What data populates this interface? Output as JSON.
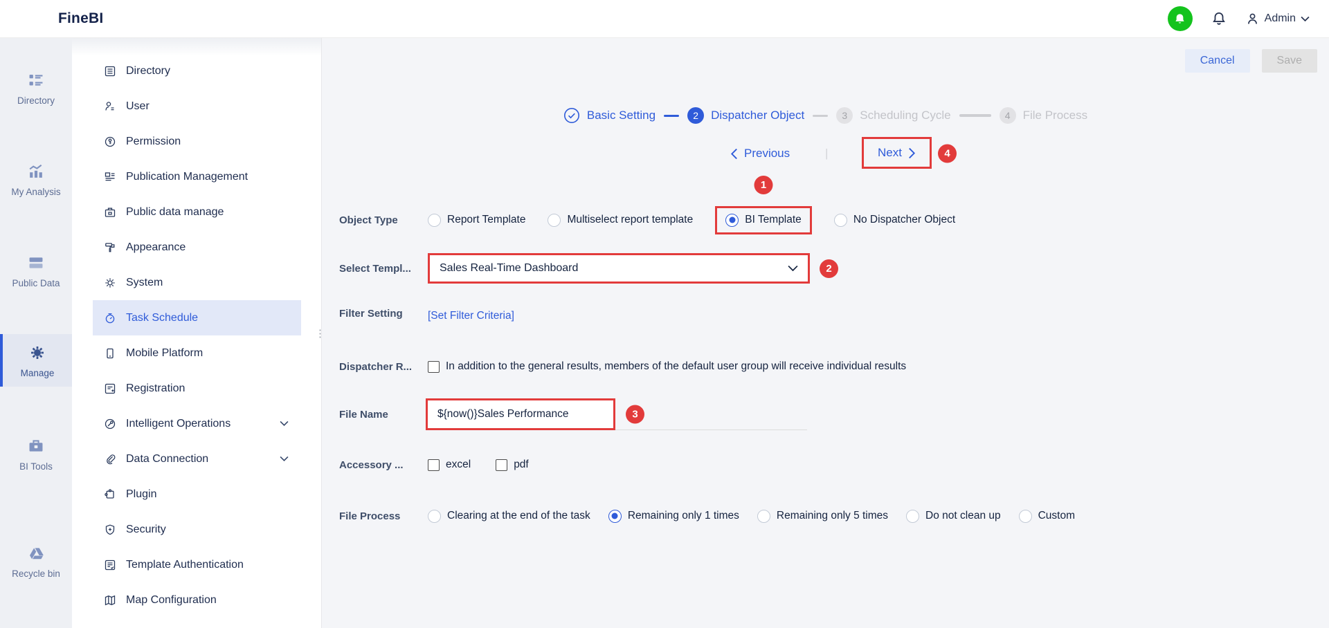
{
  "app": {
    "name": "FineBI"
  },
  "topbar": {
    "admin_label": "Admin"
  },
  "rail": {
    "items": [
      {
        "label": "Directory"
      },
      {
        "label": "My Analysis"
      },
      {
        "label": "Public Data"
      },
      {
        "label": "Manage"
      },
      {
        "label": "BI Tools"
      },
      {
        "label": "Recycle bin"
      }
    ]
  },
  "sidebar": {
    "items": [
      {
        "label": "Directory"
      },
      {
        "label": "User"
      },
      {
        "label": "Permission"
      },
      {
        "label": "Publication Management"
      },
      {
        "label": "Public data manage"
      },
      {
        "label": "Appearance"
      },
      {
        "label": "System"
      },
      {
        "label": "Task Schedule"
      },
      {
        "label": "Mobile Platform"
      },
      {
        "label": "Registration"
      },
      {
        "label": "Intelligent Operations"
      },
      {
        "label": "Data Connection"
      },
      {
        "label": "Plugin"
      },
      {
        "label": "Security"
      },
      {
        "label": "Template Authentication"
      },
      {
        "label": "Map Configuration"
      }
    ]
  },
  "toolbar": {
    "cancel_label": "Cancel",
    "save_label": "Save"
  },
  "stepper": {
    "steps": [
      {
        "num": "1",
        "label": "Basic Setting",
        "state": "done"
      },
      {
        "num": "2",
        "label": "Dispatcher Object",
        "state": "active"
      },
      {
        "num": "3",
        "label": "Scheduling Cycle",
        "state": "pending"
      },
      {
        "num": "4",
        "label": "File Process",
        "state": "pending"
      }
    ]
  },
  "wizard_nav": {
    "previous_label": "Previous",
    "next_label": "Next"
  },
  "annotations": {
    "badge1": "1",
    "badge2": "2",
    "badge3": "3",
    "badge4": "4"
  },
  "colors": {
    "accent_blue": "#2f5bd9",
    "annotation_red": "#e23b3b",
    "green_status": "#14c31d"
  },
  "form": {
    "object_type": {
      "label": "Object Type",
      "selected": "BI Template",
      "options": [
        {
          "label": "Report Template"
        },
        {
          "label": "Multiselect report template"
        },
        {
          "label": "BI Template"
        },
        {
          "label": "No Dispatcher Object"
        }
      ]
    },
    "select_template": {
      "label": "Select Templ...",
      "value": "Sales Real-Time Dashboard"
    },
    "filter_setting": {
      "label": "Filter Setting",
      "link_label": "[Set Filter Criteria]"
    },
    "dispatcher_result": {
      "label": "Dispatcher R...",
      "checkbox_label": "In addition to the general results, members of the default user group will receive individual results",
      "checked": false
    },
    "file_name": {
      "label": "File Name",
      "value": "${now()}Sales Performance"
    },
    "accessory": {
      "label": "Accessory ...",
      "options": [
        {
          "label": "excel"
        },
        {
          "label": "pdf"
        }
      ]
    },
    "file_process": {
      "label": "File Process",
      "selected": "Remaining only 1 times",
      "options": [
        {
          "label": "Clearing at the end of the task"
        },
        {
          "label": "Remaining only 1 times"
        },
        {
          "label": "Remaining only 5 times"
        },
        {
          "label": "Do not clean up"
        },
        {
          "label": "Custom"
        }
      ]
    }
  }
}
